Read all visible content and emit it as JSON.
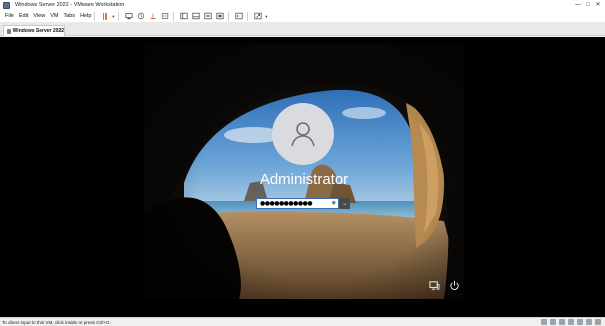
{
  "window": {
    "title": "Windows Server 2022 - VMware Workstation",
    "minimize": "—",
    "maximize": "□",
    "close": "✕"
  },
  "menu": {
    "items": [
      "File",
      "Edit",
      "View",
      "VM",
      "Tabs",
      "Help"
    ]
  },
  "toolbar": {
    "icons": [
      "pause-icon",
      "send-ctrl-alt-del-icon",
      "snapshot-icon",
      "revert-snapshot-icon",
      "snapshot-manager-icon",
      "show-library-icon",
      "thumbnail-icon",
      "fullscreen-icon",
      "unity-icon",
      "console-view-icon",
      "stretch-icon"
    ],
    "pause_color": "#e8732a"
  },
  "tab": {
    "label": "Windows Server 2022",
    "close": "×"
  },
  "login": {
    "username": "Administrator",
    "password": "●●●●●●●●●●●",
    "reveal": "◉",
    "submit": "→",
    "system_icons": [
      "network-icon",
      "power-icon"
    ]
  },
  "status": {
    "text": "To direct input to this VM, click inside or press Ctrl+G."
  }
}
